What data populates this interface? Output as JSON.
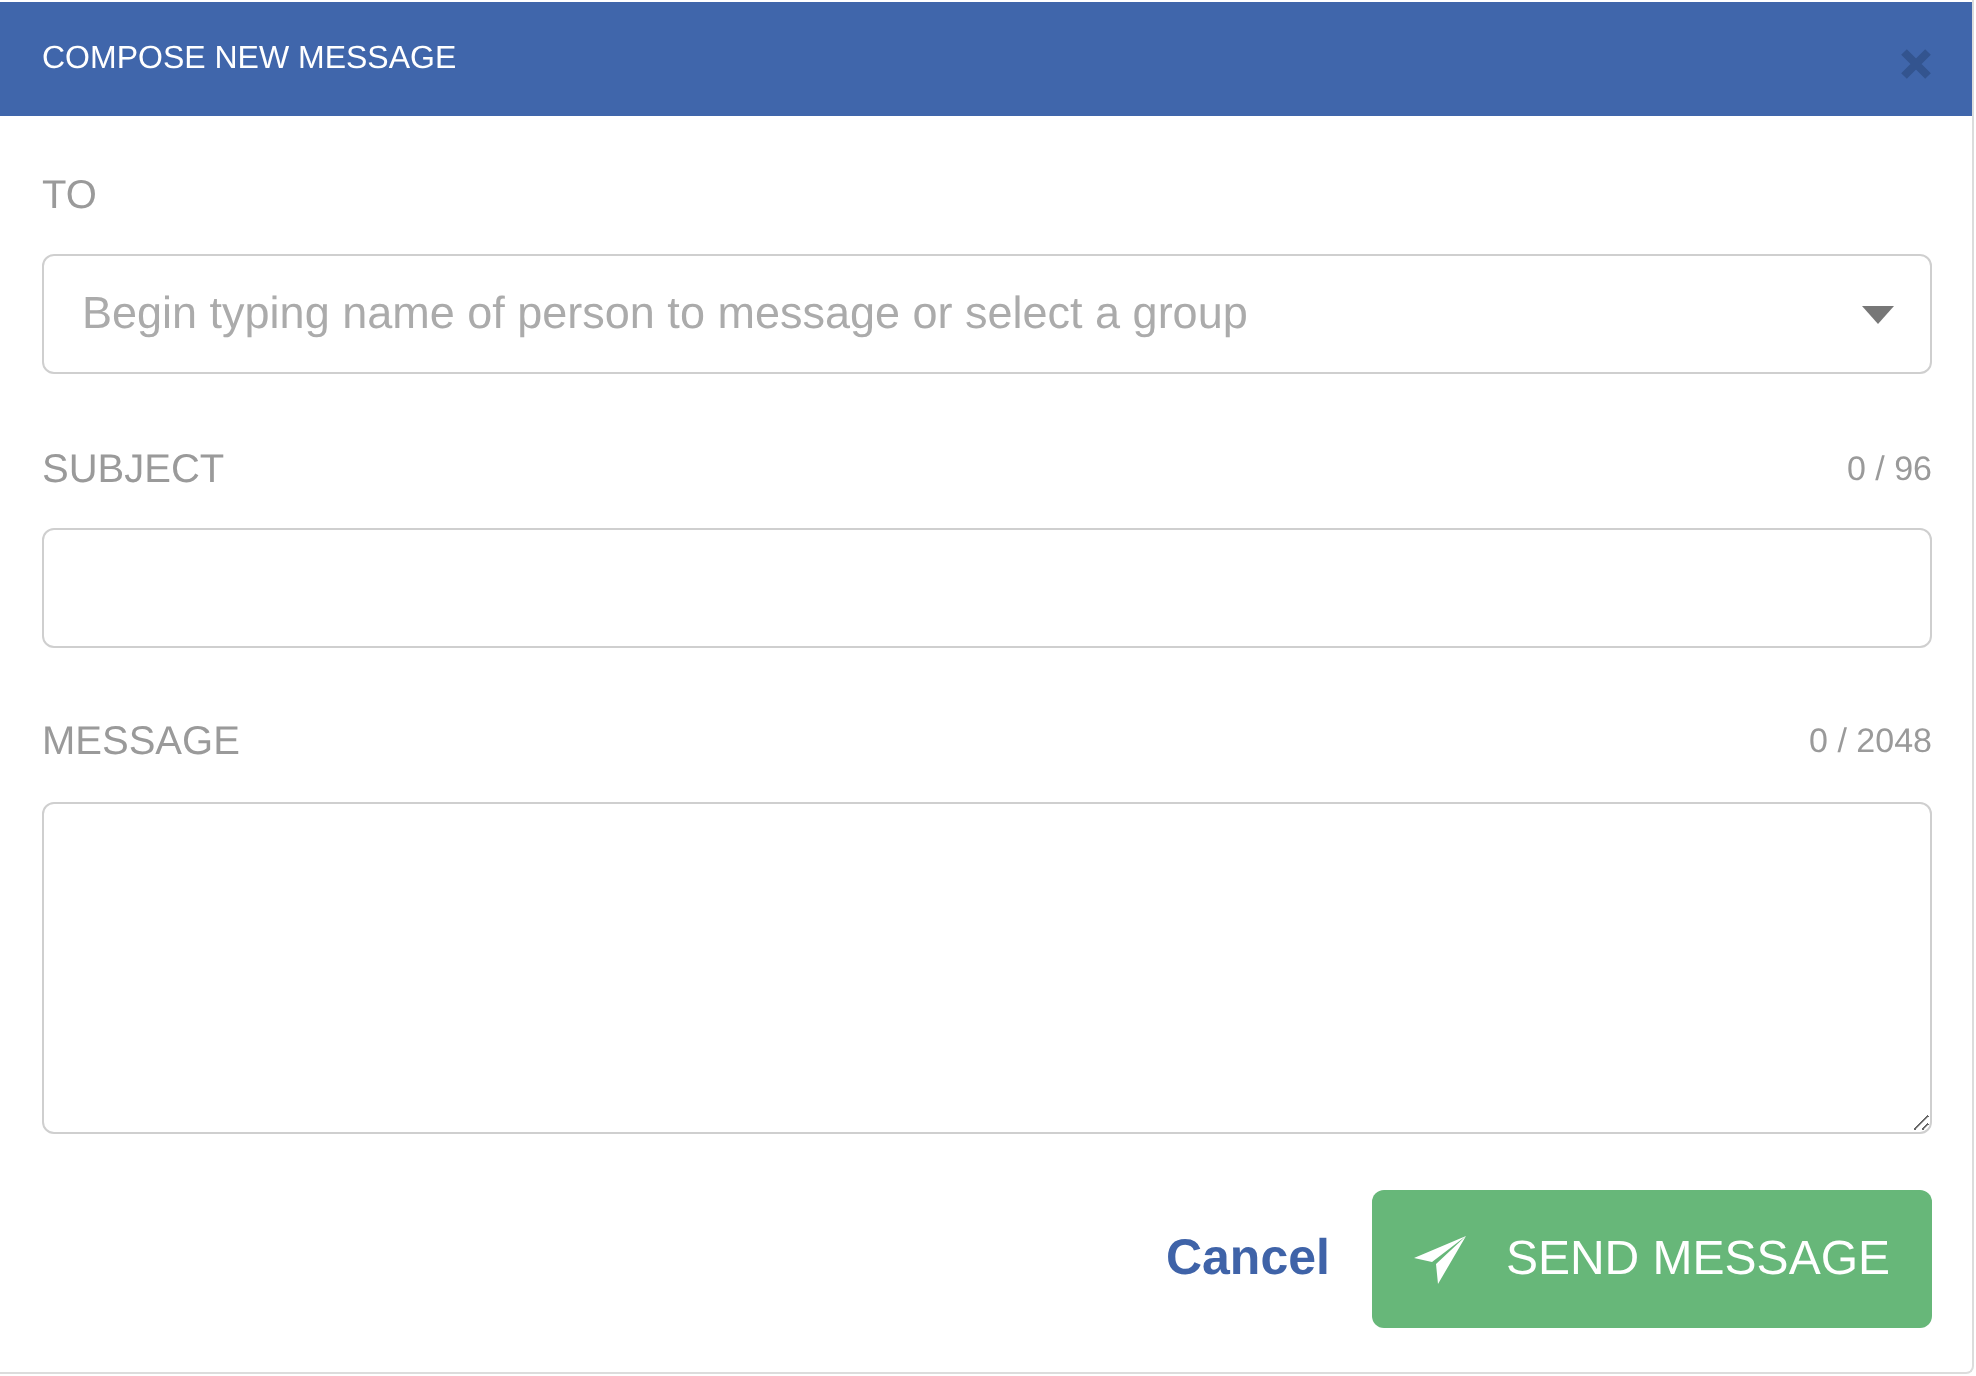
{
  "dialog": {
    "title": "COMPOSE NEW MESSAGE"
  },
  "fields": [
    {
      "kind": "select",
      "label": "TO",
      "placeholder": "Begin typing name of person to message or select a group"
    },
    {
      "kind": "input",
      "label": "SUBJECT",
      "counter": "0 / 96"
    },
    {
      "kind": "textarea",
      "label": "MESSAGE",
      "counter": "0 / 2048"
    }
  ],
  "actions": [
    {
      "kind": "link",
      "label": "Cancel"
    },
    {
      "kind": "primary",
      "label": "SEND MESSAGE"
    }
  ]
}
